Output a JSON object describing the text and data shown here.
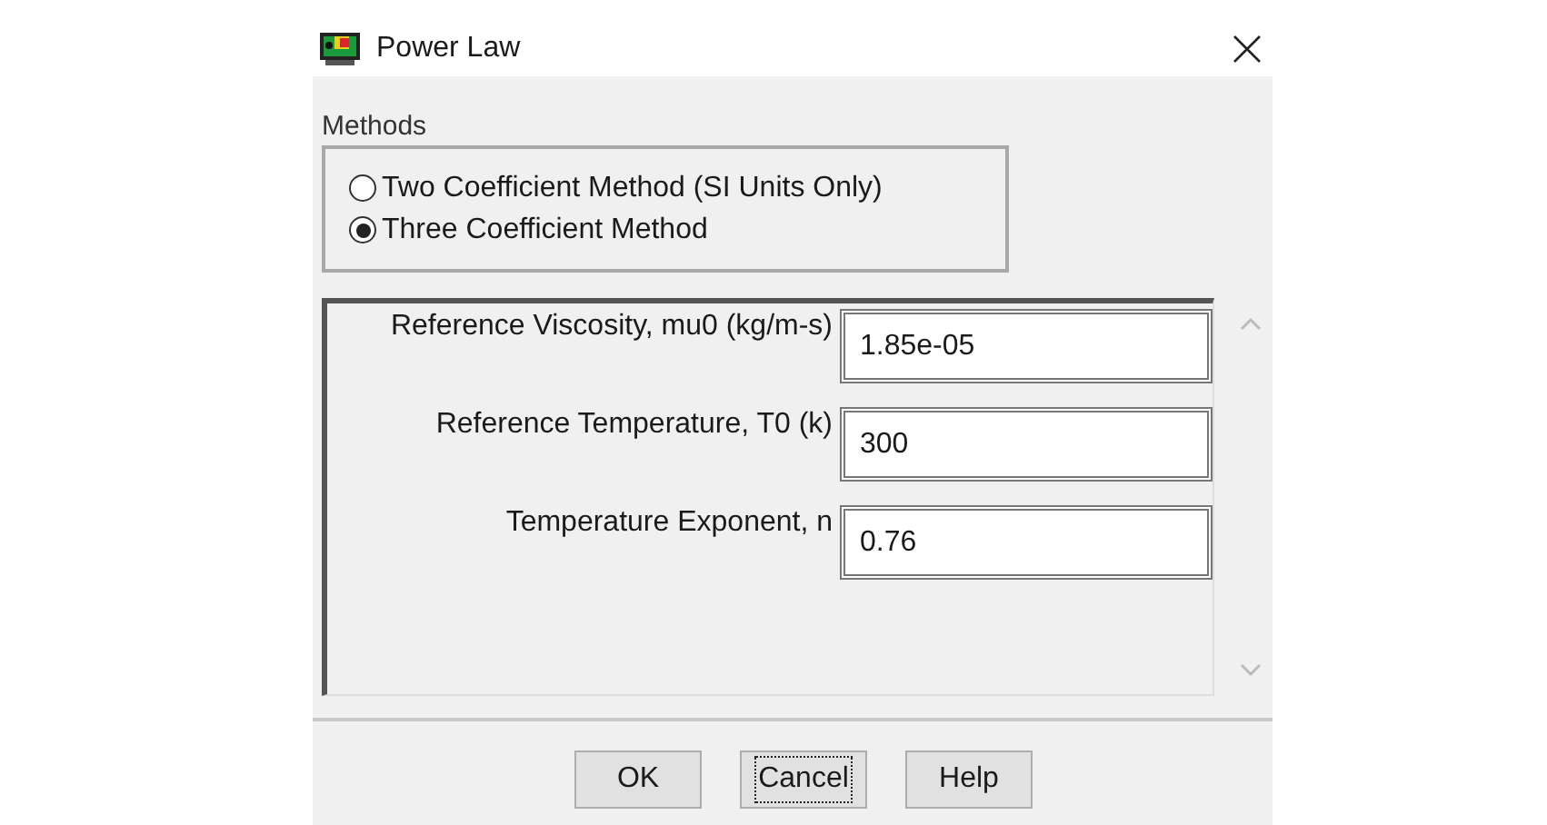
{
  "window": {
    "title": "Power Law"
  },
  "methods": {
    "label": "Methods",
    "options": [
      {
        "label": "Two Coefficient Method (SI Units Only)",
        "selected": false
      },
      {
        "label": "Three Coefficient Method",
        "selected": true
      }
    ]
  },
  "parameters": [
    {
      "label": "Reference Viscosity, mu0 (kg/m-s)",
      "value": "1.85e-05"
    },
    {
      "label": "Reference Temperature, T0 (k)",
      "value": "300"
    },
    {
      "label": "Temperature Exponent, n",
      "value": "0.76"
    }
  ],
  "buttons": [
    {
      "label": "OK",
      "focused": false
    },
    {
      "label": "Cancel",
      "focused": true
    },
    {
      "label": "Help",
      "focused": false
    }
  ]
}
